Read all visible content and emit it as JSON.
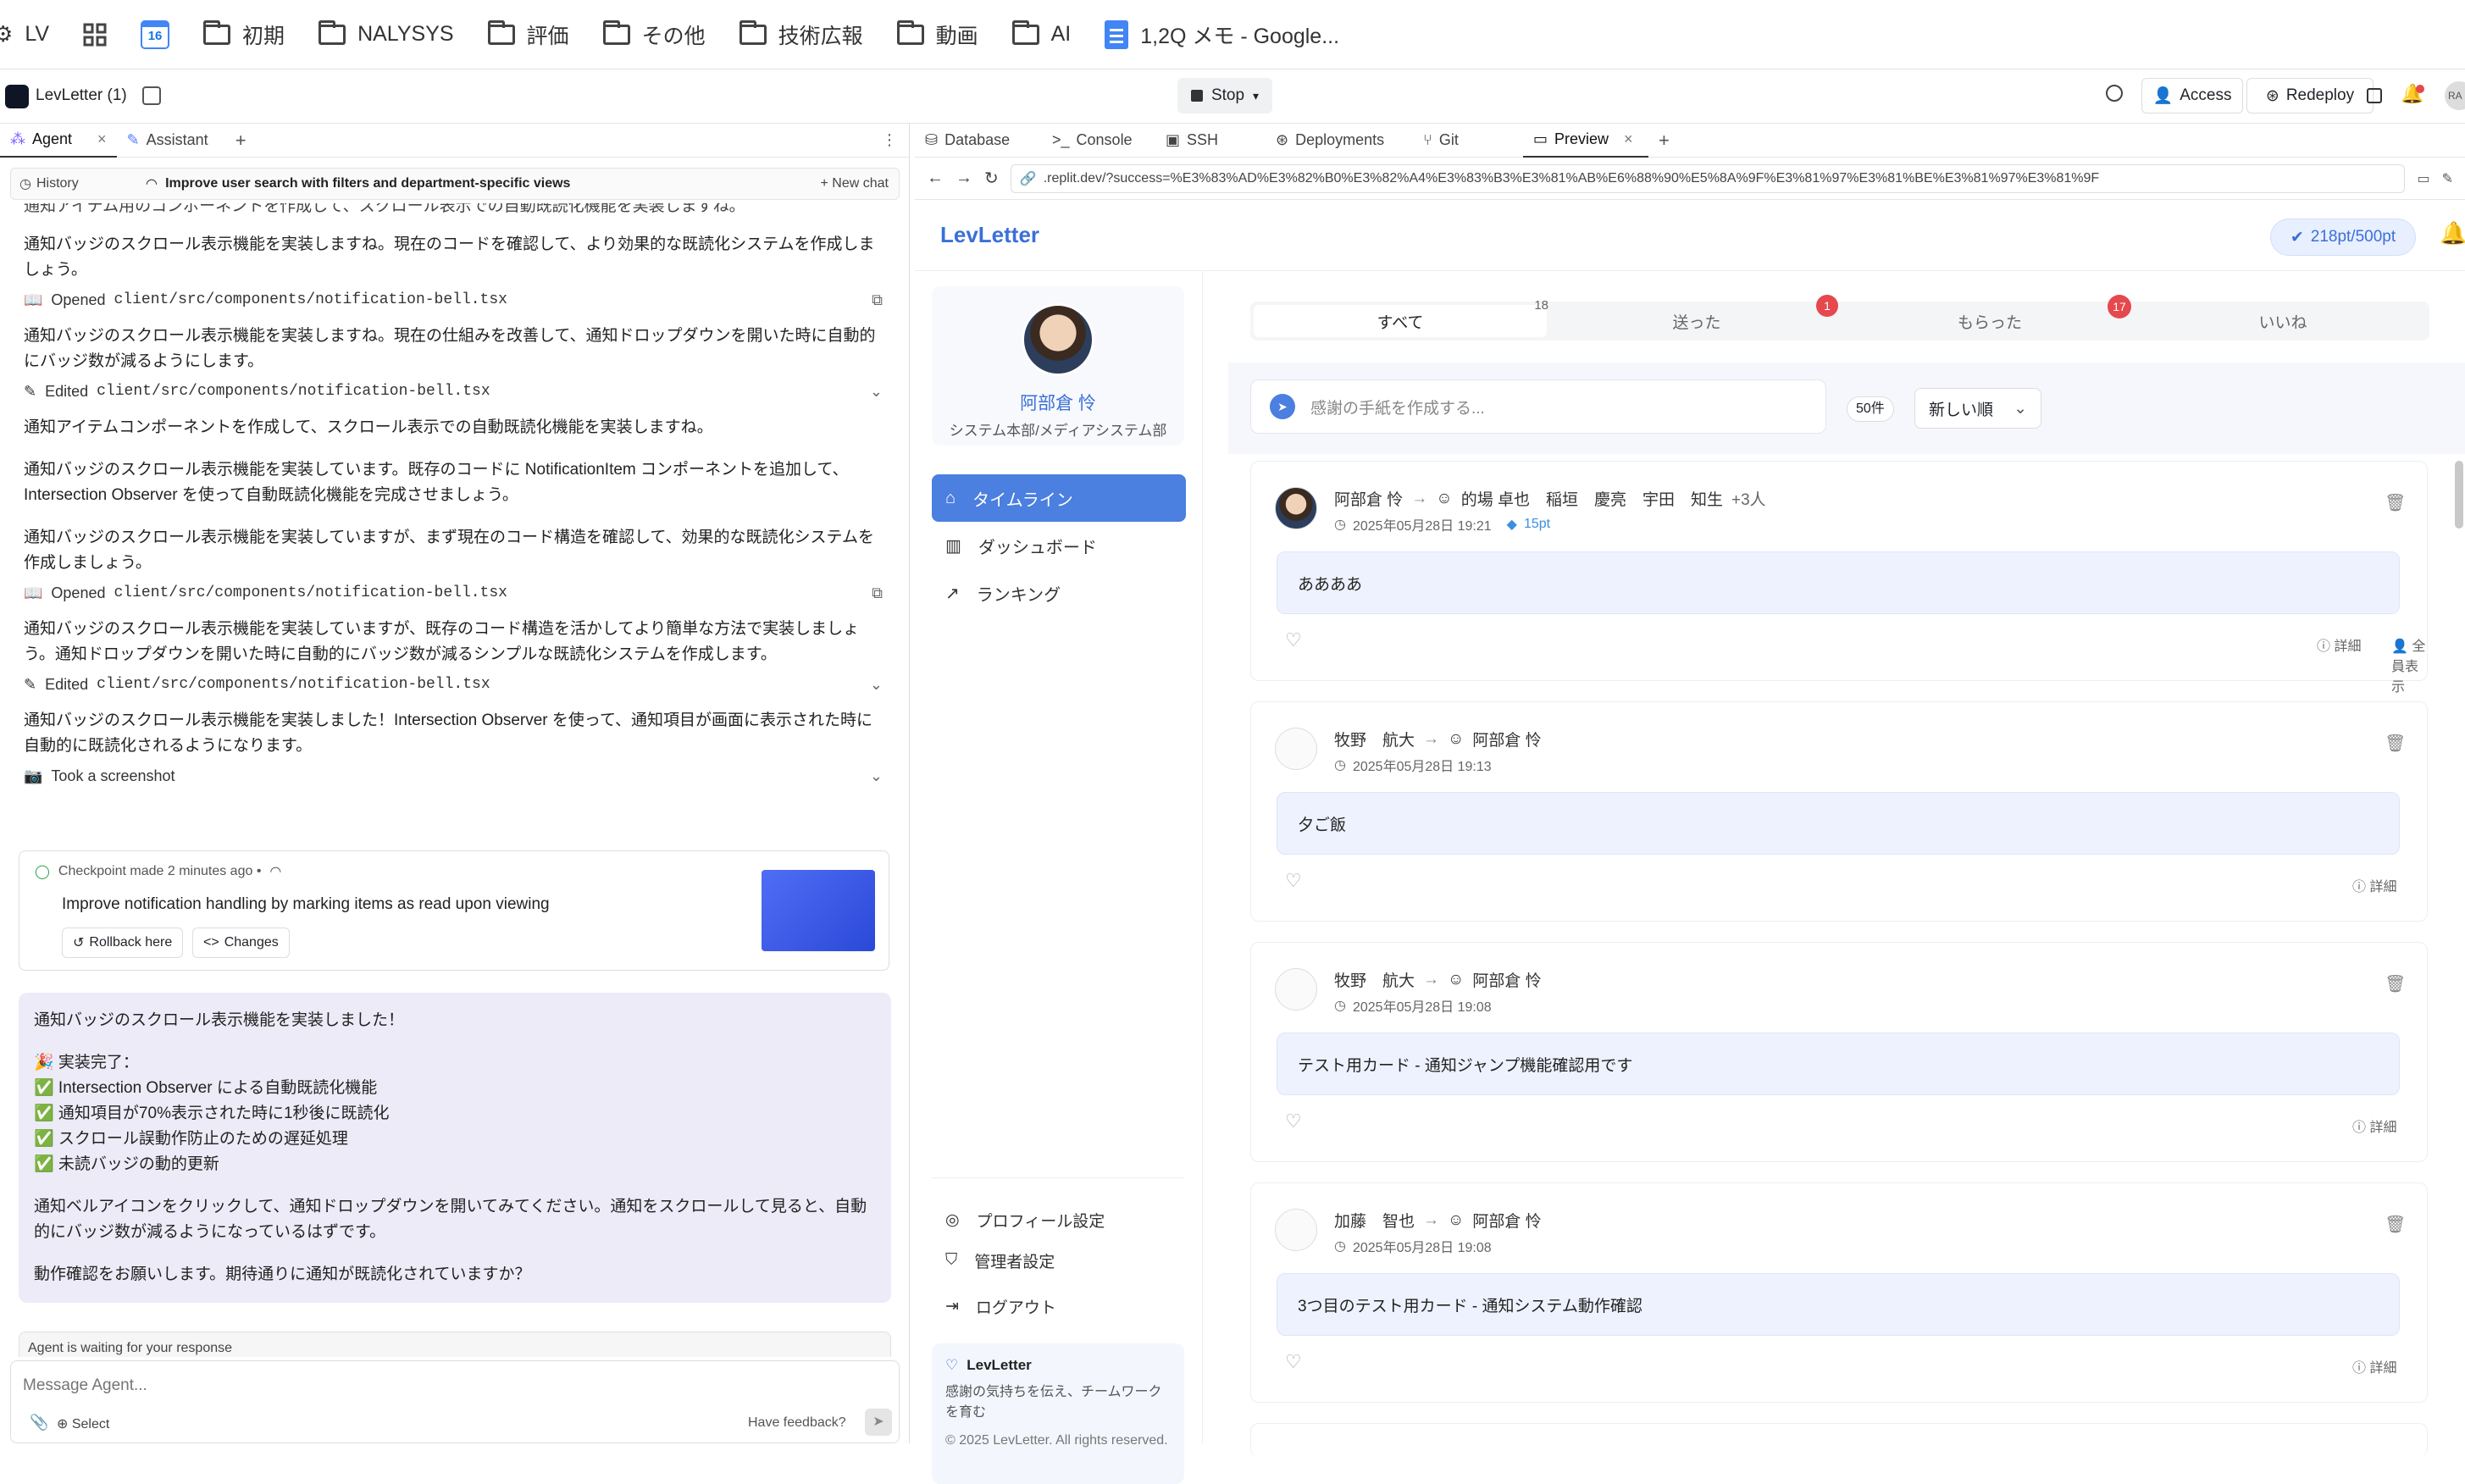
{
  "bookmarks": [
    {
      "label": "LV",
      "icon": "replit-icon"
    },
    {
      "label": "",
      "icon": "grid-icon"
    },
    {
      "label": "",
      "icon": "calendar-icon",
      "badge": "16"
    },
    {
      "label": "初期",
      "icon": "folder-icon"
    },
    {
      "label": "NALYSYS",
      "icon": "folder-icon"
    },
    {
      "label": "評価",
      "icon": "folder-icon"
    },
    {
      "label": "その他",
      "icon": "folder-icon"
    },
    {
      "label": "技術広報",
      "icon": "folder-icon"
    },
    {
      "label": "動画",
      "icon": "folder-icon"
    },
    {
      "label": "AI",
      "icon": "folder-icon"
    },
    {
      "label": "1,2Q メモ - Google...",
      "icon": "docs-icon"
    }
  ],
  "replit": {
    "project": "LevLetter (1)",
    "stop": "Stop",
    "access": "Access",
    "redeploy": "Redeploy",
    "notif_count": "1",
    "avatar": "RA"
  },
  "left_tabs": [
    "Agent",
    "Assistant"
  ],
  "agent": {
    "history": "History",
    "thread_title": "Improve user search with filters and department-specific views",
    "new_chat": "New chat",
    "cut_line": "通知アイテム用のコンポーネントを作成して、スクロール表示での自動既読化機能を実装しますね。",
    "m1": "通知バッジのスクロール表示機能を実装しますね。現在のコードを確認して、より効果的な既読化システムを作成しましょう。",
    "f1_action": "Opened",
    "f1_path": "client/src/components/notification-bell.tsx",
    "m2": "通知バッジのスクロール表示機能を実装しますね。現在の仕組みを改善して、通知ドロップダウンを開いた時に自動的にバッジ数が減るようにします。",
    "f2_action": "Edited",
    "f2_path": "client/src/components/notification-bell.tsx",
    "m3": "通知アイテムコンポーネントを作成して、スクロール表示での自動既読化機能を実装しますね。",
    "m4": "通知バッジのスクロール表示機能を実装しています。既存のコードに NotificationItem コンポーネントを追加して、Intersection Observer を使って自動既読化機能を完成させましょう。",
    "m5": "通知バッジのスクロール表示機能を実装していますが、まず現在のコード構造を確認して、効果的な既読化システムを作成しましょう。",
    "f3_action": "Opened",
    "f3_path": "client/src/components/notification-bell.tsx",
    "m6": "通知バッジのスクロール表示機能を実装していますが、既存のコード構造を活かしてより簡単な方法で実装しましょう。通知ドロップダウンを開いた時に自動的にバッジ数が減るシンプルな既読化システムを作成します。",
    "f4_action": "Edited",
    "f4_path": "client/src/components/notification-bell.tsx",
    "m7": "通知バッジのスクロール表示機能を実装しました！Intersection Observer を使って、通知項目が画面に表示された時に自動的に既読化されるようになります。",
    "screenshot": "Took a screenshot",
    "checkpoint": {
      "meta": "Checkpoint made 2 minutes ago •",
      "title": "Improve notification handling by marking items as read upon viewing",
      "rollback": "Rollback here",
      "changes": "Changes"
    },
    "summary": {
      "l1": "通知バッジのスクロール表示機能を実装しました！",
      "l2": "🎉 実装完了：",
      "items": [
        "✅ Intersection Observer による自動既読化機能",
        "✅ 通知項目が70%表示された時に1秒後に既読化",
        "✅ スクロール誤動作防止のための遅延処理",
        "✅ 未読バッジの動的更新"
      ],
      "l3": "通知ベルアイコンをクリックして、通知ドロップダウンを開いてみてください。通知をスクロールして見ると、自動的にバッジ数が減るようになっているはずです。",
      "l4": "動作確認をお願いします。期待通りに通知が既読化されていますか？"
    },
    "waiting": "Agent is waiting for your response",
    "input_placeholder": "Message Agent...",
    "select": "Select",
    "feedback": "Have feedback?"
  },
  "right_tabs": [
    "Database",
    "Console",
    "SSH",
    "Deployments",
    "Git",
    "Preview"
  ],
  "url": ".replit.dev/?success=%E3%83%AD%E3%82%B0%E3%82%A4%E3%83%B3%E3%81%AB%E6%88%90%E5%8A%9F%E3%81%97%E3%81%BE%E3%81%97%E3%81%9F",
  "app": {
    "brand": "LevLetter",
    "points": "218pt/500pt",
    "user_name": "阿部倉 怜",
    "user_dept": "システム本部/メディアシステム部",
    "nav": [
      "タイムライン",
      "ダッシュボード",
      "ランキング"
    ],
    "bottom_nav": [
      "プロフィール設定",
      "管理者設定",
      "ログアウト"
    ],
    "footer_title": "LevLetter",
    "footer_desc": "感謝の気持ちを伝え、チームワークを育む",
    "footer_copy": "© 2025 LevLetter. All rights reserved.",
    "filter_tabs": [
      {
        "label": "すべて",
        "count": "18"
      },
      {
        "label": "送った",
        "count": "1"
      },
      {
        "label": "もらった",
        "count": "17"
      },
      {
        "label": "いいね",
        "count": ""
      }
    ],
    "compose_placeholder": "感謝の手紙を作成する...",
    "count_label": "50件",
    "sort": "新しい順",
    "detail": "詳細",
    "show_all": "全員表示",
    "cards": [
      {
        "sender": "阿部倉 怜",
        "recipients": "的場 卓也　稲垣　慶亮　宇田　知生",
        "more": "+3人",
        "date": "2025年05月28日 19:21",
        "pt": "15pt",
        "body": "ああああ"
      },
      {
        "sender": "牧野　航大",
        "recipients": "阿部倉 怜",
        "more": "",
        "date": "2025年05月28日 19:13",
        "pt": "",
        "body": "夕ご飯"
      },
      {
        "sender": "牧野　航大",
        "recipients": "阿部倉 怜",
        "more": "",
        "date": "2025年05月28日 19:08",
        "pt": "",
        "body": "テスト用カード - 通知ジャンプ機能確認用です"
      },
      {
        "sender": "加藤　智也",
        "recipients": "阿部倉 怜",
        "more": "",
        "date": "2025年05月28日 19:08",
        "pt": "",
        "body": "3つ目のテスト用カード - 通知システム動作確認"
      }
    ]
  }
}
